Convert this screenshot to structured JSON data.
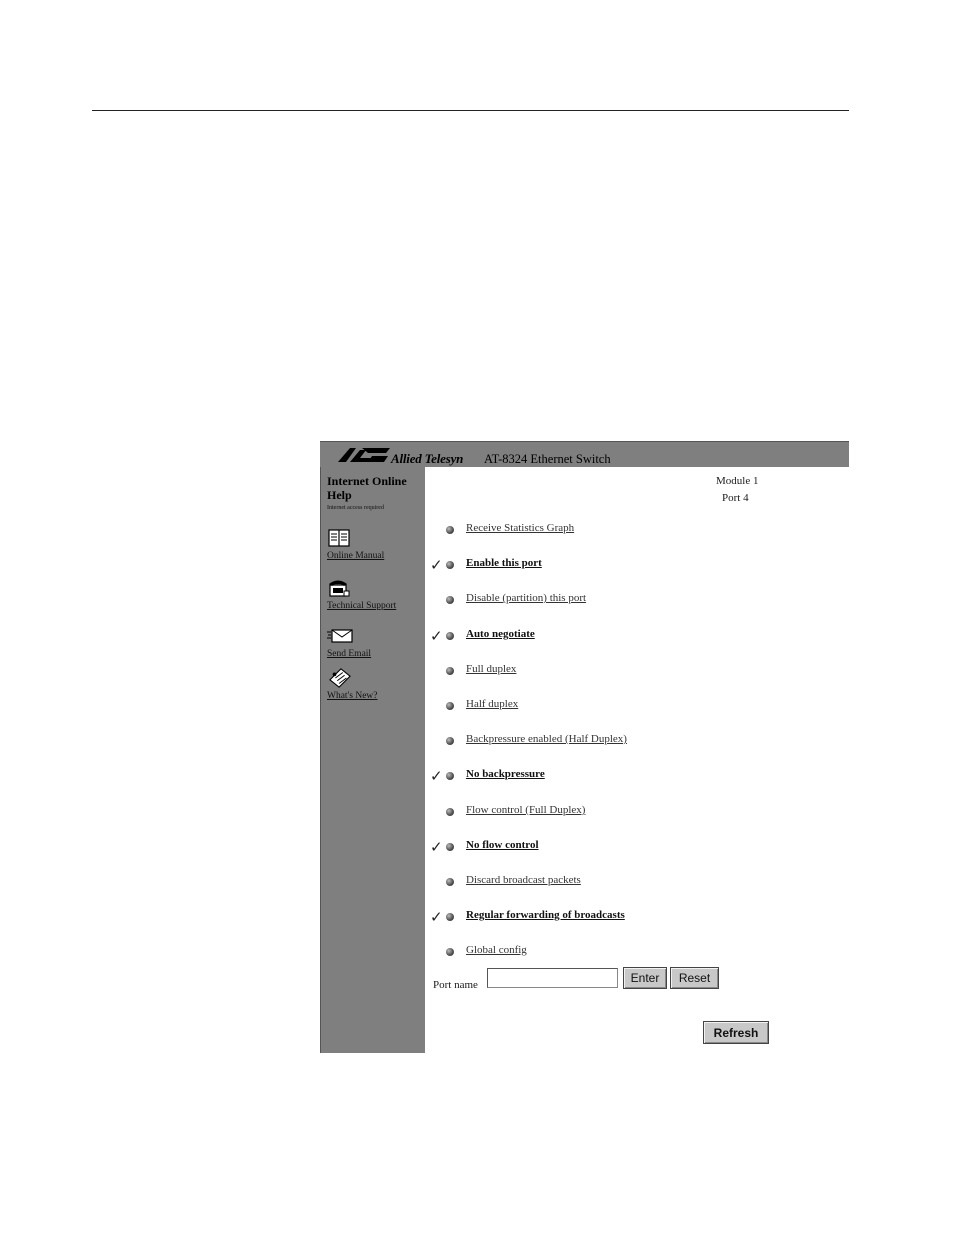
{
  "banner": {
    "brand": "Allied Telesyn",
    "product": "AT-8324 Ethernet Switch"
  },
  "sidebar": {
    "title": "Internet Online Help",
    "note": "Internet access required",
    "links": [
      {
        "label": "Online Manual",
        "icon": "book-icon"
      },
      {
        "label": "Technical Support",
        "icon": "phone-icon"
      },
      {
        "label": "Send Email",
        "icon": "envelope-icon"
      },
      {
        "label": "What's New?",
        "icon": "news-icon"
      }
    ]
  },
  "header": {
    "module": "Module 1",
    "port": "Port 4"
  },
  "options": [
    {
      "label": "Receive Statistics Graph",
      "checked": false
    },
    {
      "label": "Enable this port",
      "checked": true
    },
    {
      "label": "Disable (partition) this port",
      "checked": false
    },
    {
      "label": "Auto negotiate",
      "checked": true
    },
    {
      "label": "Full duplex",
      "checked": false
    },
    {
      "label": "Half duplex",
      "checked": false
    },
    {
      "label": "Backpressure enabled (Half Duplex)",
      "checked": false
    },
    {
      "label": "No backpressure",
      "checked": true
    },
    {
      "label": "Flow control (Full Duplex)",
      "checked": false
    },
    {
      "label": "No flow control",
      "checked": true
    },
    {
      "label": "Discard broadcast packets",
      "checked": false
    },
    {
      "label": "Regular forwarding of broadcasts",
      "checked": true
    },
    {
      "label": "Global config",
      "checked": false
    }
  ],
  "check_glyph": "✓",
  "port_form": {
    "label": "Port name",
    "value": "",
    "enter_label": "Enter",
    "reset_label": "Reset"
  },
  "refresh_label": "Refresh"
}
